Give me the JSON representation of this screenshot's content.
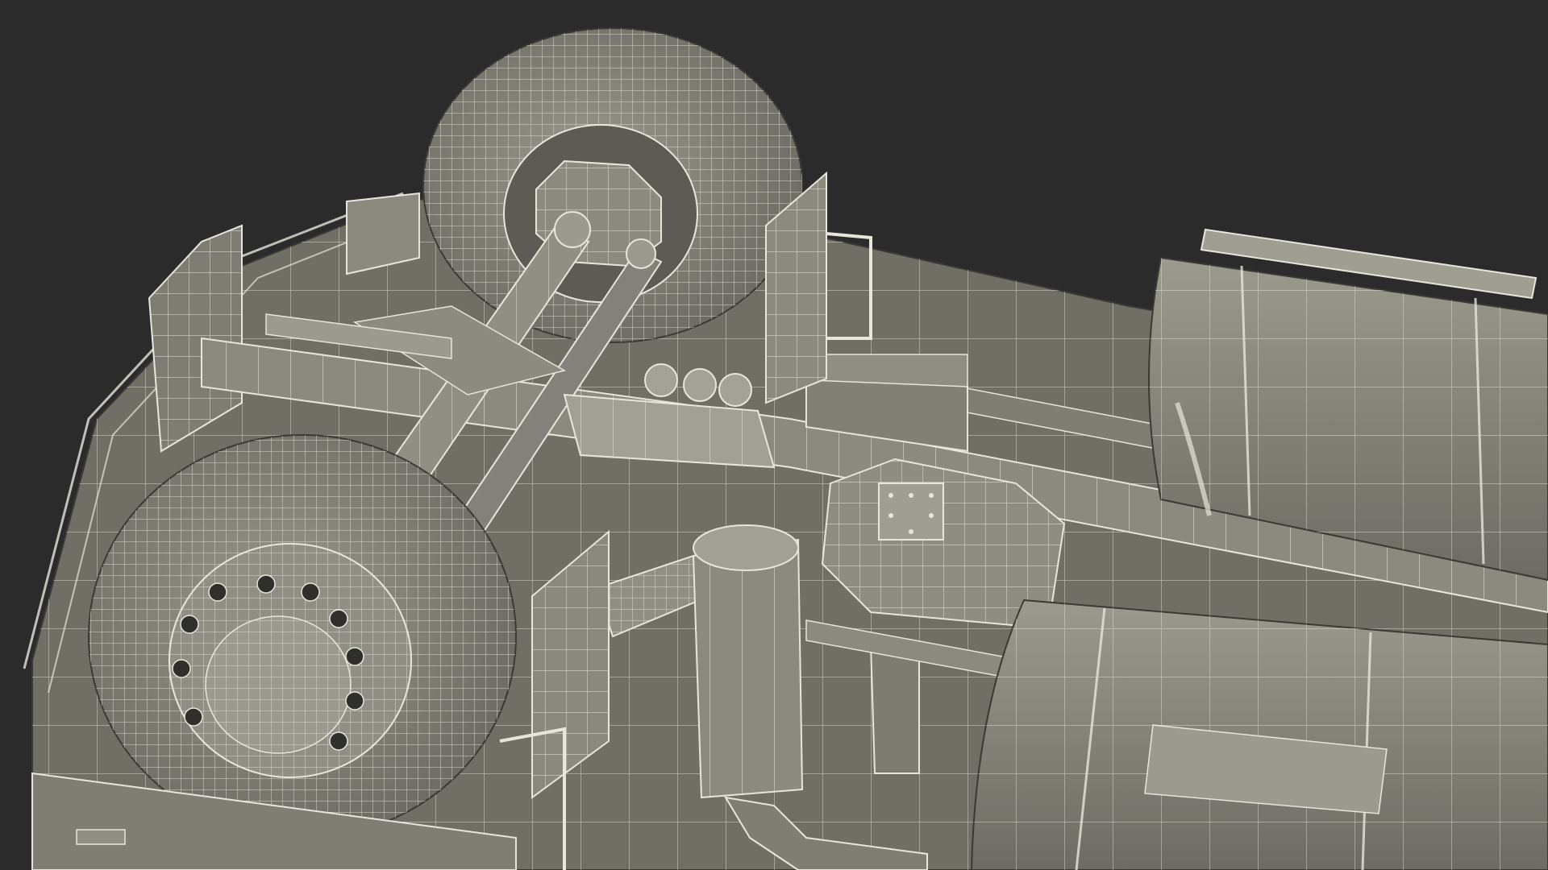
{
  "scene": {
    "subject": "truck-chassis-underside-wireframe",
    "colors": {
      "background": "#2b2b2b",
      "surface": "#8d8d82",
      "surface_dark": "#6f6f66",
      "surface_shadow": "#55554e",
      "wire": "#e6e6dc",
      "edge": "#3a3a35"
    }
  }
}
